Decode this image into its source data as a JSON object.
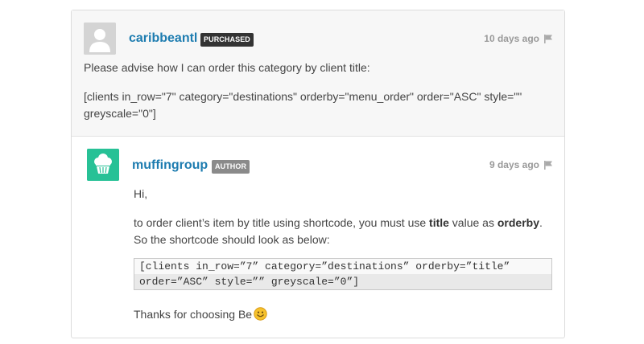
{
  "comments": [
    {
      "username": "caribbeantl",
      "badge": "PURCHASED",
      "time": "10 days ago",
      "avatar": "default-user-avatar",
      "body": [
        "Please advise how I can order this category by client title:",
        "[clients in_row=\"7\" category=\"destinations\" orderby=\"menu_order\" order=\"ASC\" style=\"\"",
        "greyscale=\"0\"]"
      ]
    },
    {
      "username": "muffingroup",
      "badge": "AUTHOR",
      "time": "9 days ago",
      "avatar": "muffin-logo-avatar",
      "greeting": "Hi,",
      "para1_part1": "to order client’s item by title using shortcode, you must use ",
      "para1_bold1": "title",
      "para1_part2": " value as ",
      "para1_bold2": "orderby",
      "para1_part3": ".",
      "para1_line2": "So the shortcode should look as below:",
      "code_lines": [
        "[clients in_row=”7” category=”destinations” orderby=”title”",
        "order=”ASC” style=”” greyscale=”0”]"
      ],
      "closing": "Thanks for choosing Be",
      "closing_emoji": "smiley-emoji"
    }
  ],
  "icons": {
    "flag": "flag-icon",
    "accent": "#1d7cb0",
    "author_avatar_bg": "#27c196"
  }
}
